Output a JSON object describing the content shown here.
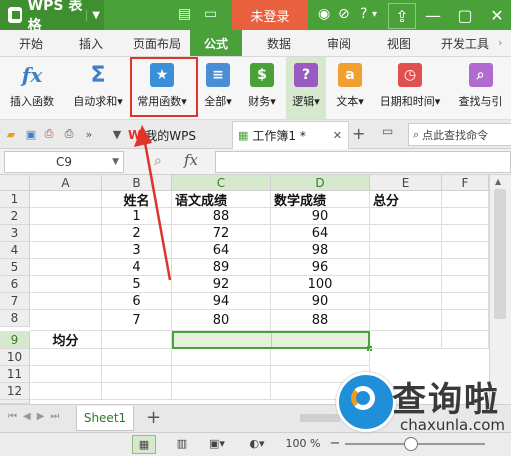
{
  "app": {
    "title": "WPS 表格",
    "login_label": "未登录"
  },
  "menu_tabs": [
    "开始",
    "插入",
    "页面布局",
    "公式",
    "数据",
    "审阅",
    "视图",
    "开发工具"
  ],
  "active_tab": "公式",
  "ribbon": {
    "buttons": [
      {
        "label": "插入函数",
        "icon": "fx-icon"
      },
      {
        "label": "自动求和",
        "icon": "sigma-icon",
        "dropdown": true
      },
      {
        "label": "常用函数",
        "icon": "star-function-icon",
        "dropdown": true,
        "highlighted": true
      },
      {
        "label": "全部",
        "icon": "all-functions-icon",
        "dropdown": true
      },
      {
        "label": "财务",
        "icon": "finance-icon",
        "dropdown": true
      },
      {
        "label": "逻辑",
        "icon": "logic-icon",
        "dropdown": true
      },
      {
        "label": "文本",
        "icon": "text-icon",
        "dropdown": true
      },
      {
        "label": "日期和时间",
        "icon": "datetime-icon",
        "dropdown": true
      },
      {
        "label": "查找与引",
        "icon": "lookup-icon"
      }
    ]
  },
  "doc_tabs": {
    "mywps": "我的WPS",
    "workbook": "工作簿1 *",
    "search_placeholder": "点此查找命令"
  },
  "formula_bar": {
    "name_box": "C9",
    "fx": "fx",
    "value": ""
  },
  "columns": [
    "A",
    "B",
    "C",
    "D",
    "E",
    "F"
  ],
  "rows": [
    "1",
    "2",
    "3",
    "4",
    "5",
    "6",
    "7",
    "8",
    "9",
    "10",
    "11",
    "12",
    "13"
  ],
  "table": {
    "header": {
      "b": "姓名",
      "c": "语文成绩",
      "d": "数学成绩",
      "e": "总分"
    },
    "records": [
      {
        "b": "1",
        "c": "88",
        "d": "90"
      },
      {
        "b": "2",
        "c": "72",
        "d": "64"
      },
      {
        "b": "3",
        "c": "64",
        "d": "98"
      },
      {
        "b": "4",
        "c": "89",
        "d": "96"
      },
      {
        "b": "5",
        "c": "92",
        "d": "100"
      },
      {
        "b": "6",
        "c": "94",
        "d": "90"
      },
      {
        "b": "7",
        "c": "80",
        "d": "88"
      }
    ],
    "avg_label": "均分"
  },
  "sheet": {
    "name": "Sheet1"
  },
  "status": {
    "zoom": "100 %"
  },
  "watermark": {
    "text": "查询啦",
    "url": "chaxunla.com"
  },
  "colors": {
    "accent": "#4aa13a",
    "login": "#e9603f",
    "annotation": "#e0332a"
  }
}
